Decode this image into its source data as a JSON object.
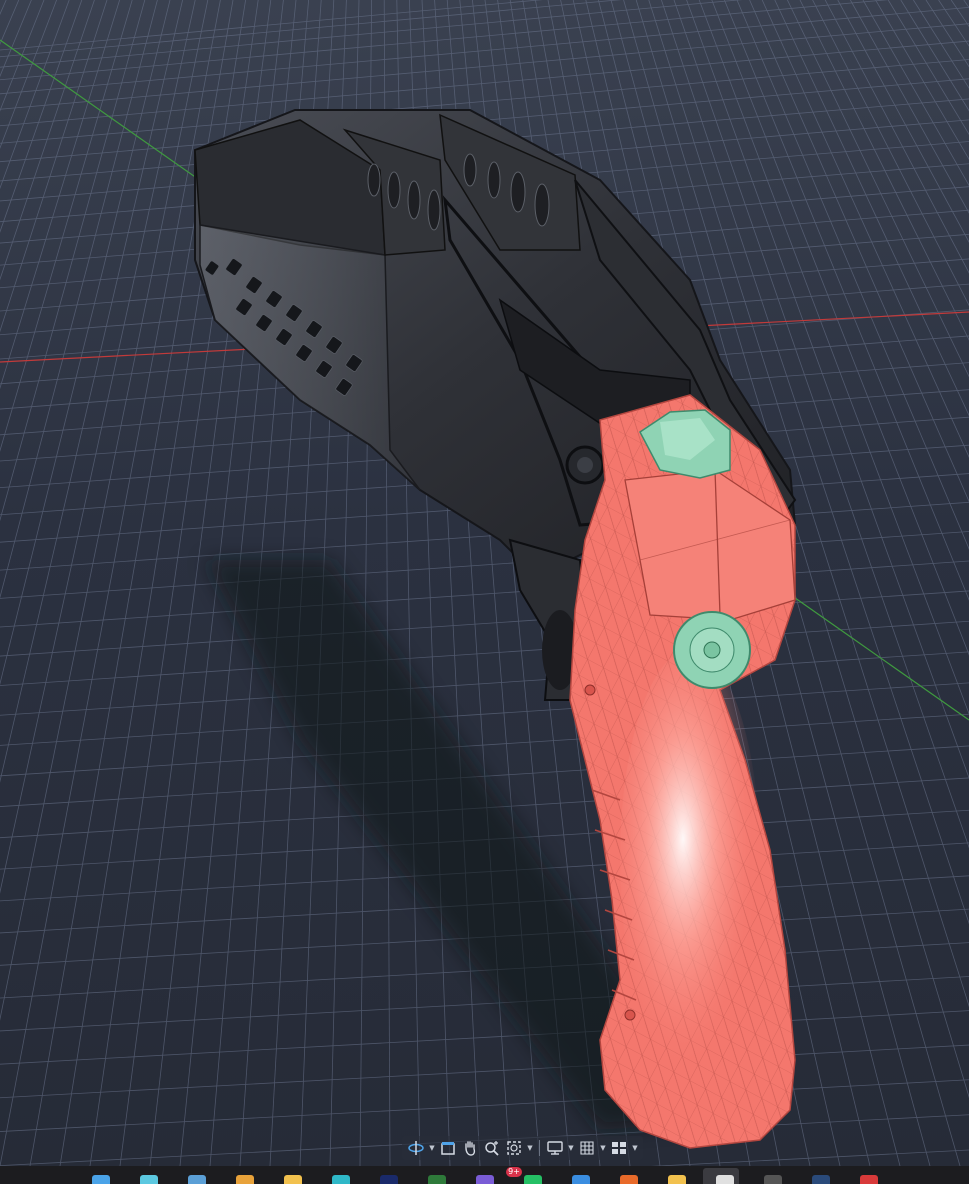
{
  "viewport": {
    "background": "#262b37",
    "grid_color": "#6e7891",
    "axis_x_color": "#c23a3a",
    "axis_y_color": "#3f9a3f",
    "model_colors": {
      "receiver": "#2e3035",
      "grip": "#f4776d",
      "component_accent": "#8fd3b4"
    }
  },
  "nav_toolbar": {
    "tools": [
      {
        "name": "orbit-icon",
        "has_menu": true
      },
      {
        "name": "look-at-icon",
        "has_menu": false
      },
      {
        "name": "pan-hand-icon",
        "has_menu": false
      },
      {
        "name": "zoom-icon",
        "has_menu": false
      },
      {
        "name": "fit-window-icon",
        "has_menu": true
      },
      {
        "name": "display-settings-icon",
        "has_menu": true
      },
      {
        "name": "grid-snap-icon",
        "has_menu": true
      },
      {
        "name": "viewports-icon",
        "has_menu": true
      }
    ]
  },
  "taskbar": {
    "notification_badge": "9+",
    "icon_colors": [
      "#4aa3e8",
      "#5cc8e0",
      "#5b9fd6",
      "#e8a23a",
      "#f2c14e",
      "#2fb8c8",
      "#1a2a6a",
      "#2e7a3a",
      "#7a5cd6",
      "#25c065",
      "#3a8de0",
      "#e86a2a",
      "#f2c14e",
      "#e0e0e0",
      "#555555",
      "#2a4a7a",
      "#d83a3a"
    ]
  }
}
